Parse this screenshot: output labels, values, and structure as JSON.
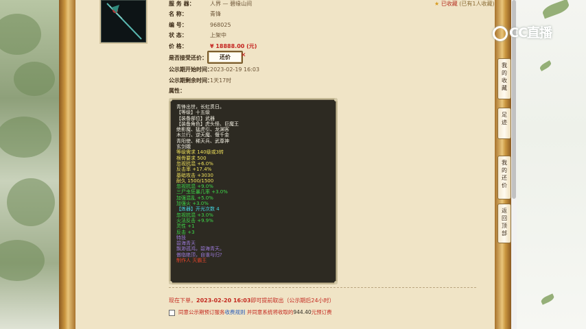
{
  "watermark": {
    "brand": "CC直播"
  },
  "favorite": {
    "label": "已收藏",
    "count_text": "(已有1人收藏)"
  },
  "item": {
    "fields": [
      {
        "label": "服 务 器：",
        "value": "人界 — 碧缘山间"
      },
      {
        "label": "名      称：",
        "value": "青锋"
      },
      {
        "label": "编      号：",
        "value": "968025"
      },
      {
        "label": "状      态：",
        "value": "上架中"
      },
      {
        "label": "价      格：",
        "value": "¥ 18888.00 (元)"
      }
    ],
    "haggle": {
      "label": "是否接受还价：",
      "button": "还价"
    },
    "publicity_start": {
      "label": "公示期开始时间：",
      "value": "2023-02-19 16:03"
    },
    "publicity_remaining": {
      "label": "公示期剩余时间：",
      "value": "1天17时"
    },
    "attributes_label": "属性："
  },
  "attributes": [
    {
      "text": "青锋出世，长虹贯日。",
      "color": "w"
    },
    {
      "text": "【等级】十五级",
      "color": "w"
    },
    {
      "text": "【装备部位】武器",
      "color": "w"
    },
    {
      "text": "【装备角色】虎头怪、巨魔王",
      "color": "w"
    },
    {
      "text": "绝影魔、猛虎引、龙渊客",
      "color": "w"
    },
    {
      "text": "木兰行、逆天魔、偃千金",
      "color": "w"
    },
    {
      "text": "青阳使、稀天兵、武尊神",
      "color": "w"
    },
    {
      "text": "玄剑娥",
      "color": "w"
    },
    {
      "text": "等级需求 140级或3转",
      "color": "y"
    },
    {
      "text": "根骨要求 500",
      "color": "y"
    },
    {
      "text": "忽视抗混 +6.0%",
      "color": "y"
    },
    {
      "text": "反击率 +17.4%",
      "color": "y"
    },
    {
      "text": "基础攻击 +3030",
      "color": "y"
    },
    {
      "text": "耐久 1500/1500",
      "color": "y"
    },
    {
      "text": "忽视抗混 +9.0%",
      "color": "g"
    },
    {
      "text": "三尸虫狂暴几率 +3.0%",
      "color": "g"
    },
    {
      "text": "加强混乱 +5.0%",
      "color": "g"
    },
    {
      "text": "加强火 +3.0%",
      "color": "g"
    },
    {
      "text": " ",
      "color": "w"
    },
    {
      "text": "【炼器】开光次数 4",
      "color": "c"
    },
    {
      "text": "忽视抗混 +3.0%",
      "color": "g"
    },
    {
      "text": "火法反击 +9.9%",
      "color": "g"
    },
    {
      "text": "灵性 +1",
      "color": "g"
    },
    {
      "text": "反击 +3",
      "color": "g"
    },
    {
      "text": "特技",
      "color": "p"
    },
    {
      "text": "碧海青天",
      "color": "p"
    },
    {
      "text": "飘渺孤鸿，碧海青天。",
      "color": "p"
    },
    {
      "text": "傲临绝顶，自谁与归?",
      "color": "p"
    },
    {
      "text": "制作人 灭霸王",
      "color": "r"
    }
  ],
  "order_notice": {
    "prefix": "现在下单，",
    "date": "2023-02-20 16:03",
    "suffix": "即可提前取出（公示期后24小时）"
  },
  "agreement": {
    "before": "同意公示期预订服务",
    "link": "收费规则",
    "middle": " 并同意系统将收取的",
    "amount": "944.40",
    "after": "元预订费"
  },
  "side_nav": [
    {
      "label": "我的收藏"
    },
    {
      "label": "足迹"
    },
    {
      "label": "我的还价"
    },
    {
      "label": "返回顶部"
    }
  ]
}
